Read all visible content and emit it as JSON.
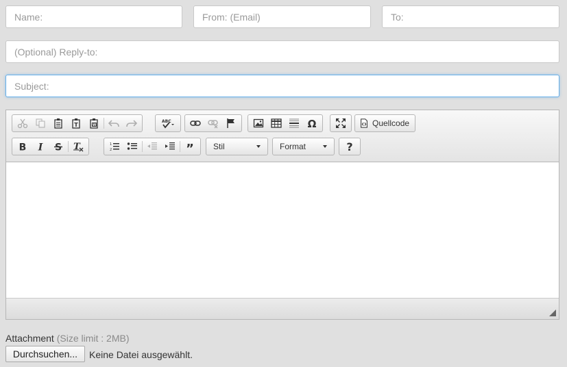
{
  "form": {
    "name_placeholder": "Name:",
    "from_placeholder": "From: (Email)",
    "to_placeholder": "To:",
    "reply_placeholder": "(Optional) Reply-to:",
    "subject_placeholder": "Subject:"
  },
  "toolbar": {
    "icons": [
      "cut-icon",
      "copy-icon",
      "paste-icon",
      "paste-text-icon",
      "paste-word-icon",
      "undo-icon",
      "redo-icon",
      "spellcheck-icon",
      "link-icon",
      "unlink-icon",
      "anchor-icon",
      "image-icon",
      "table-icon",
      "horizontal-line-icon",
      "special-char-icon",
      "maximize-icon",
      "source-icon",
      "bold-icon",
      "italic-icon",
      "strike-icon",
      "remove-format-icon",
      "numbered-list-icon",
      "bulleted-list-icon",
      "outdent-icon",
      "indent-icon",
      "blockquote-icon",
      "help-icon"
    ],
    "source_label": "Quellcode",
    "style_label": "Stil",
    "format_label": "Format"
  },
  "attachment": {
    "label": "Attachment",
    "limit": "(Size limit : 2MB)",
    "browse_label": "Durchsuchen...",
    "status": "Keine Datei ausgewählt."
  },
  "colors": {
    "focus": "#66afe9",
    "background": "#e0e0e0"
  }
}
